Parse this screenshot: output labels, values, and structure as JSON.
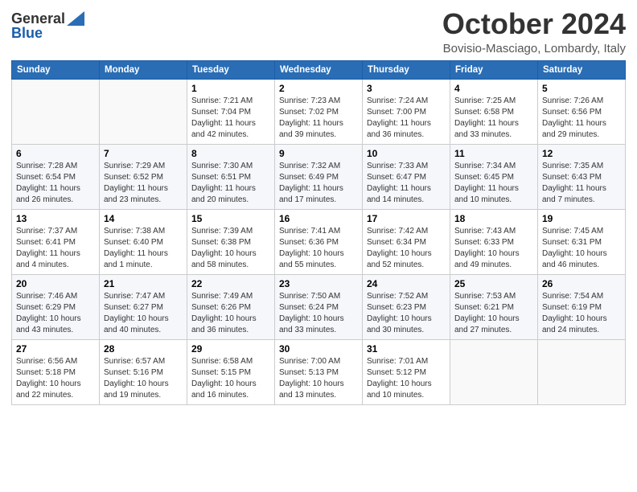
{
  "header": {
    "logo_general": "General",
    "logo_blue": "Blue",
    "month_title": "October 2024",
    "location": "Bovisio-Masciago, Lombardy, Italy"
  },
  "calendar": {
    "days_of_week": [
      "Sunday",
      "Monday",
      "Tuesday",
      "Wednesday",
      "Thursday",
      "Friday",
      "Saturday"
    ],
    "weeks": [
      [
        {
          "day": "",
          "info": ""
        },
        {
          "day": "",
          "info": ""
        },
        {
          "day": "1",
          "info": "Sunrise: 7:21 AM\nSunset: 7:04 PM\nDaylight: 11 hours and 42 minutes."
        },
        {
          "day": "2",
          "info": "Sunrise: 7:23 AM\nSunset: 7:02 PM\nDaylight: 11 hours and 39 minutes."
        },
        {
          "day": "3",
          "info": "Sunrise: 7:24 AM\nSunset: 7:00 PM\nDaylight: 11 hours and 36 minutes."
        },
        {
          "day": "4",
          "info": "Sunrise: 7:25 AM\nSunset: 6:58 PM\nDaylight: 11 hours and 33 minutes."
        },
        {
          "day": "5",
          "info": "Sunrise: 7:26 AM\nSunset: 6:56 PM\nDaylight: 11 hours and 29 minutes."
        }
      ],
      [
        {
          "day": "6",
          "info": "Sunrise: 7:28 AM\nSunset: 6:54 PM\nDaylight: 11 hours and 26 minutes."
        },
        {
          "day": "7",
          "info": "Sunrise: 7:29 AM\nSunset: 6:52 PM\nDaylight: 11 hours and 23 minutes."
        },
        {
          "day": "8",
          "info": "Sunrise: 7:30 AM\nSunset: 6:51 PM\nDaylight: 11 hours and 20 minutes."
        },
        {
          "day": "9",
          "info": "Sunrise: 7:32 AM\nSunset: 6:49 PM\nDaylight: 11 hours and 17 minutes."
        },
        {
          "day": "10",
          "info": "Sunrise: 7:33 AM\nSunset: 6:47 PM\nDaylight: 11 hours and 14 minutes."
        },
        {
          "day": "11",
          "info": "Sunrise: 7:34 AM\nSunset: 6:45 PM\nDaylight: 11 hours and 10 minutes."
        },
        {
          "day": "12",
          "info": "Sunrise: 7:35 AM\nSunset: 6:43 PM\nDaylight: 11 hours and 7 minutes."
        }
      ],
      [
        {
          "day": "13",
          "info": "Sunrise: 7:37 AM\nSunset: 6:41 PM\nDaylight: 11 hours and 4 minutes."
        },
        {
          "day": "14",
          "info": "Sunrise: 7:38 AM\nSunset: 6:40 PM\nDaylight: 11 hours and 1 minute."
        },
        {
          "day": "15",
          "info": "Sunrise: 7:39 AM\nSunset: 6:38 PM\nDaylight: 10 hours and 58 minutes."
        },
        {
          "day": "16",
          "info": "Sunrise: 7:41 AM\nSunset: 6:36 PM\nDaylight: 10 hours and 55 minutes."
        },
        {
          "day": "17",
          "info": "Sunrise: 7:42 AM\nSunset: 6:34 PM\nDaylight: 10 hours and 52 minutes."
        },
        {
          "day": "18",
          "info": "Sunrise: 7:43 AM\nSunset: 6:33 PM\nDaylight: 10 hours and 49 minutes."
        },
        {
          "day": "19",
          "info": "Sunrise: 7:45 AM\nSunset: 6:31 PM\nDaylight: 10 hours and 46 minutes."
        }
      ],
      [
        {
          "day": "20",
          "info": "Sunrise: 7:46 AM\nSunset: 6:29 PM\nDaylight: 10 hours and 43 minutes."
        },
        {
          "day": "21",
          "info": "Sunrise: 7:47 AM\nSunset: 6:27 PM\nDaylight: 10 hours and 40 minutes."
        },
        {
          "day": "22",
          "info": "Sunrise: 7:49 AM\nSunset: 6:26 PM\nDaylight: 10 hours and 36 minutes."
        },
        {
          "day": "23",
          "info": "Sunrise: 7:50 AM\nSunset: 6:24 PM\nDaylight: 10 hours and 33 minutes."
        },
        {
          "day": "24",
          "info": "Sunrise: 7:52 AM\nSunset: 6:23 PM\nDaylight: 10 hours and 30 minutes."
        },
        {
          "day": "25",
          "info": "Sunrise: 7:53 AM\nSunset: 6:21 PM\nDaylight: 10 hours and 27 minutes."
        },
        {
          "day": "26",
          "info": "Sunrise: 7:54 AM\nSunset: 6:19 PM\nDaylight: 10 hours and 24 minutes."
        }
      ],
      [
        {
          "day": "27",
          "info": "Sunrise: 6:56 AM\nSunset: 5:18 PM\nDaylight: 10 hours and 22 minutes."
        },
        {
          "day": "28",
          "info": "Sunrise: 6:57 AM\nSunset: 5:16 PM\nDaylight: 10 hours and 19 minutes."
        },
        {
          "day": "29",
          "info": "Sunrise: 6:58 AM\nSunset: 5:15 PM\nDaylight: 10 hours and 16 minutes."
        },
        {
          "day": "30",
          "info": "Sunrise: 7:00 AM\nSunset: 5:13 PM\nDaylight: 10 hours and 13 minutes."
        },
        {
          "day": "31",
          "info": "Sunrise: 7:01 AM\nSunset: 5:12 PM\nDaylight: 10 hours and 10 minutes."
        },
        {
          "day": "",
          "info": ""
        },
        {
          "day": "",
          "info": ""
        }
      ]
    ]
  }
}
